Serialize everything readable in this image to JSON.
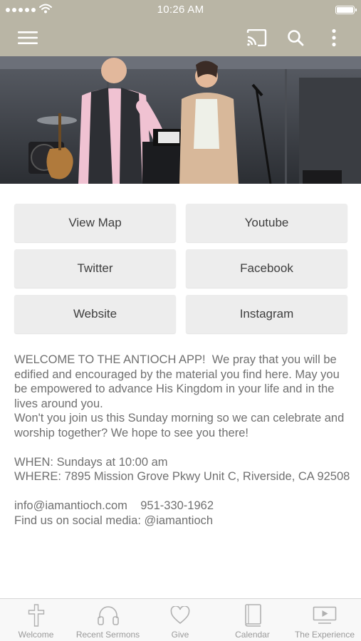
{
  "status_bar": {
    "time": "10:26 AM"
  },
  "toolbar": {
    "menu_icon": "hamburger-menu-icon",
    "cast_icon": "cast-icon",
    "search_icon": "search-icon",
    "more_icon": "more-vertical-icon"
  },
  "links": [
    {
      "label": "View Map"
    },
    {
      "label": "Youtube"
    },
    {
      "label": "Twitter"
    },
    {
      "label": "Facebook"
    },
    {
      "label": "Website"
    },
    {
      "label": "Instagram"
    }
  ],
  "welcome_text": "WELCOME TO THE ANTIOCH APP!  We pray that you will be edified and encouraged by the material you find here. May you be empowered to advance His Kingdom in your life and in the lives around you.\nWon't you join us this Sunday morning so we can celebrate and worship together? We hope to see you there!\n\nWHEN: Sundays at 10:00 am\nWHERE: 7895 Mission Grove Pkwy Unit C, Riverside, CA 92508\n\ninfo@iamantioch.com    951-330-1962\nFind us on social media: @iamantioch",
  "tabs": [
    {
      "label": "Welcome",
      "icon": "cross-icon"
    },
    {
      "label": "Recent Sermons",
      "icon": "headphones-icon"
    },
    {
      "label": "Give",
      "icon": "heart-icon"
    },
    {
      "label": "Calendar",
      "icon": "book-icon"
    },
    {
      "label": "The Experience",
      "icon": "video-play-icon"
    }
  ],
  "colors": {
    "header_bg": "#b9b5a5",
    "button_bg": "#ededed",
    "text": "#707070",
    "tab_label": "#9a9a9a"
  }
}
